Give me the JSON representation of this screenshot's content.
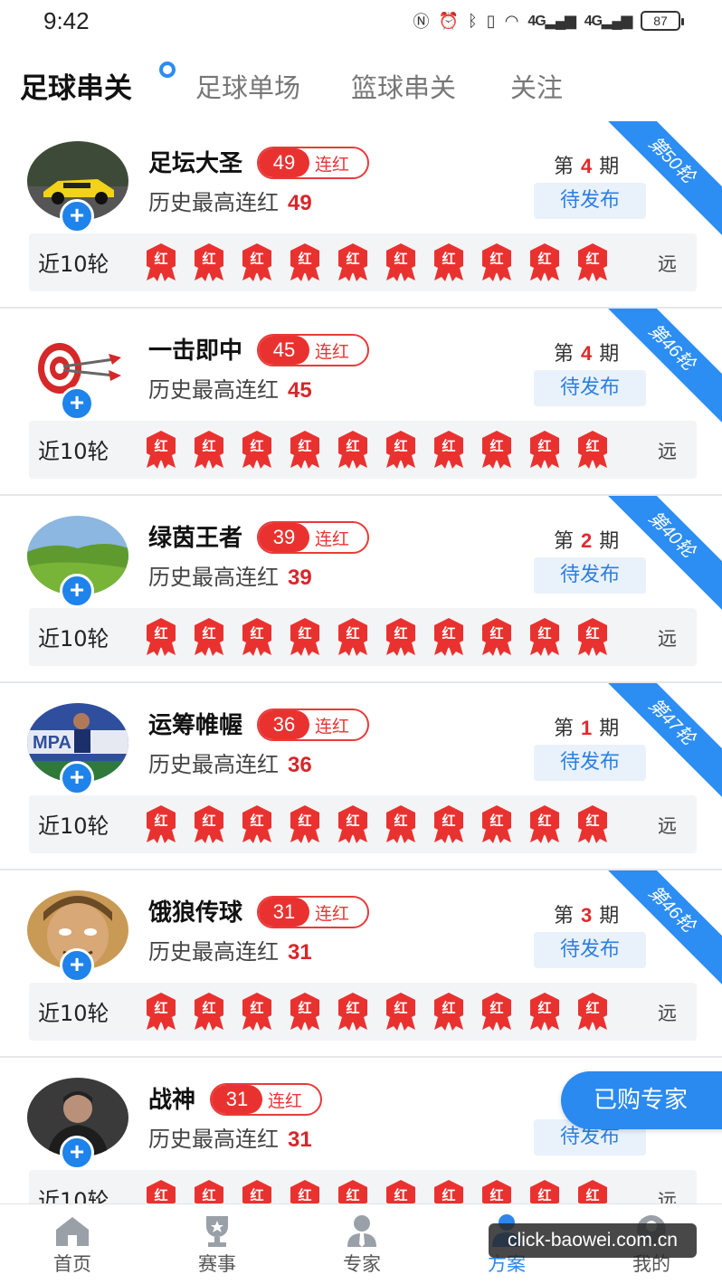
{
  "status": {
    "time": "9:42",
    "battery": "87",
    "signal1": "4G",
    "signal2": "4G"
  },
  "tabs": [
    {
      "label": "足球串关",
      "active": true
    },
    {
      "label": "足球单场",
      "active": false
    },
    {
      "label": "篮球串关",
      "active": false
    },
    {
      "label": "关注",
      "active": false
    }
  ],
  "colors": {
    "accent": "#2b8cf2",
    "red": "#e9322f",
    "pending_bg": "#e9f1fb"
  },
  "cards": [
    {
      "name": "足坛大圣",
      "streak": "49",
      "streak_label": "连红",
      "history_label": "历史最高连红",
      "history": "49",
      "issue_prefix": "第",
      "issue": "4",
      "issue_suffix": "期",
      "status": "待发布",
      "ribbon": "第50轮",
      "recent_label": "近10轮",
      "results": [
        "红",
        "红",
        "红",
        "红",
        "红",
        "红",
        "红",
        "红",
        "红",
        "红"
      ],
      "more": "远",
      "avatar": "car"
    },
    {
      "name": "一击即中",
      "streak": "45",
      "streak_label": "连红",
      "history_label": "历史最高连红",
      "history": "45",
      "issue_prefix": "第",
      "issue": "4",
      "issue_suffix": "期",
      "status": "待发布",
      "ribbon": "第46轮",
      "recent_label": "近10轮",
      "results": [
        "红",
        "红",
        "红",
        "红",
        "红",
        "红",
        "红",
        "红",
        "红",
        "红"
      ],
      "more": "远",
      "avatar": "target"
    },
    {
      "name": "绿茵王者",
      "streak": "39",
      "streak_label": "连红",
      "history_label": "历史最高连红",
      "history": "39",
      "issue_prefix": "第",
      "issue": "2",
      "issue_suffix": "期",
      "status": "待发布",
      "ribbon": "第40轮",
      "recent_label": "近10轮",
      "results": [
        "红",
        "红",
        "红",
        "红",
        "红",
        "红",
        "红",
        "红",
        "红",
        "红"
      ],
      "more": "远",
      "avatar": "grass"
    },
    {
      "name": "运筹帷幄",
      "streak": "36",
      "streak_label": "连红",
      "history_label": "历史最高连红",
      "history": "36",
      "issue_prefix": "第",
      "issue": "1",
      "issue_suffix": "期",
      "status": "待发布",
      "ribbon": "第47轮",
      "recent_label": "近10轮",
      "results": [
        "红",
        "红",
        "红",
        "红",
        "红",
        "红",
        "红",
        "红",
        "红",
        "红"
      ],
      "more": "远",
      "avatar": "player"
    },
    {
      "name": "饿狼传球",
      "streak": "31",
      "streak_label": "连红",
      "history_label": "历史最高连红",
      "history": "31",
      "issue_prefix": "第",
      "issue": "3",
      "issue_suffix": "期",
      "status": "待发布",
      "ribbon": "第46轮",
      "recent_label": "近10轮",
      "results": [
        "红",
        "红",
        "红",
        "红",
        "红",
        "红",
        "红",
        "红",
        "红",
        "红"
      ],
      "more": "远",
      "avatar": "face"
    },
    {
      "name": "战神",
      "streak": "31",
      "streak_label": "连红",
      "history_label": "历史最高连红",
      "history": "31",
      "issue_prefix": "第",
      "issue": "",
      "issue_suffix": "",
      "status": "待发布",
      "ribbon": "",
      "recent_label": "近10轮",
      "results": [
        "红",
        "红",
        "红",
        "红",
        "红",
        "红",
        "红",
        "红",
        "红",
        "红"
      ],
      "more": "远",
      "avatar": "man"
    }
  ],
  "float_button": "已购专家",
  "bottom_nav": [
    {
      "label": "首页",
      "icon": "home-icon",
      "active": false
    },
    {
      "label": "赛事",
      "icon": "trophy-icon",
      "active": false
    },
    {
      "label": "专家",
      "icon": "expert-icon",
      "active": false
    },
    {
      "label": "方案",
      "icon": "plan-icon",
      "active": true
    },
    {
      "label": "我的",
      "icon": "profile-icon",
      "active": false
    }
  ],
  "watermark": "click-baowei.com.cn"
}
